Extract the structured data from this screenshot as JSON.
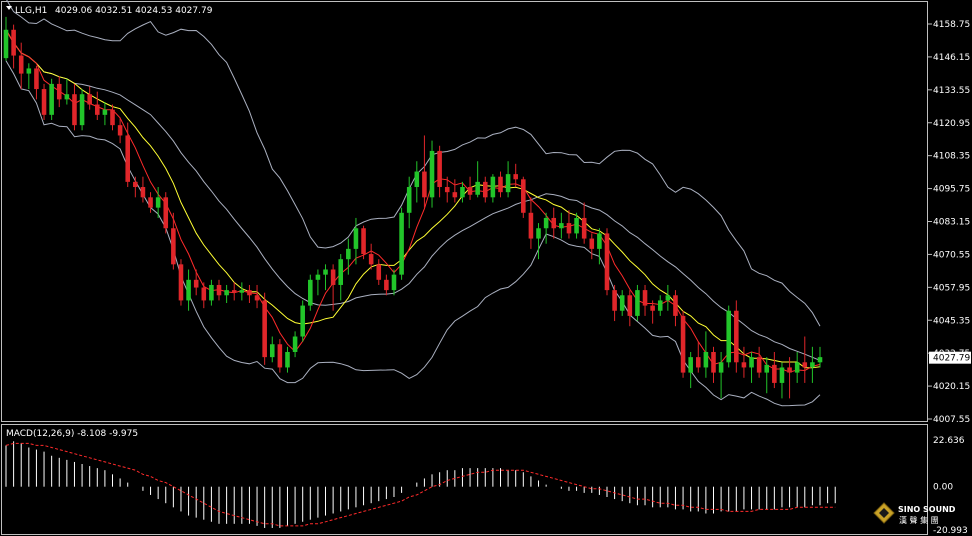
{
  "header": {
    "symbol": "LLG,H1",
    "ohlc": "4029.06 4032.51 4024.53 4027.79"
  },
  "macd_header": {
    "label": "MACD(12,26,9) -8.108 -9.975"
  },
  "price_axis": {
    "ticks": [
      "4158.75",
      "4146.15",
      "4133.55",
      "4120.95",
      "4108.35",
      "4095.75",
      "4083.15",
      "4070.55",
      "4057.95",
      "4045.35",
      "4032.75",
      "4020.15",
      "4007.55"
    ],
    "current_price": "4027.79"
  },
  "macd_axis": {
    "ticks": [
      "22.636",
      "0.00",
      "-20.993"
    ]
  },
  "logo": {
    "name": "SINO SOUND",
    "cn": "漢 聲 集 團"
  },
  "colors": {
    "bull": "#22c52a",
    "bear": "#e0262a",
    "fast_ma": "#ff2b2b",
    "slow_ma": "#ffff33",
    "bands": "#aab0c0",
    "macd_signal": "#ff2b2b",
    "macd_hist": "#ffffff"
  },
  "chart_data": {
    "type": "candlestick",
    "timeframe": "H1",
    "ylim": [
      4004,
      4165
    ],
    "candles": [
      [
        4144,
        4160,
        4143,
        4155
      ],
      [
        4155,
        4157,
        4140,
        4145
      ],
      [
        4145,
        4150,
        4132,
        4138
      ],
      [
        4138,
        4142,
        4132,
        4140
      ],
      [
        4140,
        4141,
        4128,
        4132
      ],
      [
        4132,
        4134,
        4120,
        4122
      ],
      [
        4122,
        4136,
        4120,
        4134
      ],
      [
        4134,
        4137,
        4125,
        4128
      ],
      [
        4128,
        4136,
        4126,
        4130
      ],
      [
        4130,
        4134,
        4116,
        4118
      ],
      [
        4118,
        4132,
        4116,
        4130
      ],
      [
        4130,
        4133,
        4124,
        4126
      ],
      [
        4126,
        4131,
        4120,
        4122
      ],
      [
        4122,
        4127,
        4118,
        4124
      ],
      [
        4124,
        4126,
        4116,
        4118
      ],
      [
        4118,
        4121,
        4111,
        4114
      ],
      [
        4114,
        4119,
        4094,
        4096
      ],
      [
        4096,
        4098,
        4090,
        4094
      ],
      [
        4094,
        4098,
        4088,
        4090
      ],
      [
        4090,
        4092,
        4084,
        4086
      ],
      [
        4086,
        4094,
        4082,
        4090
      ],
      [
        4090,
        4092,
        4076,
        4078
      ],
      [
        4078,
        4084,
        4062,
        4064
      ],
      [
        4064,
        4066,
        4048,
        4050
      ],
      [
        4050,
        4062,
        4046,
        4058
      ],
      [
        4058,
        4062,
        4052,
        4055
      ],
      [
        4055,
        4057,
        4047,
        4050
      ],
      [
        4050,
        4058,
        4048,
        4056
      ],
      [
        4056,
        4058,
        4050,
        4052
      ],
      [
        4052,
        4056,
        4049,
        4054
      ],
      [
        4054,
        4057,
        4050,
        4053
      ],
      [
        4053,
        4057,
        4050,
        4054
      ],
      [
        4054,
        4056,
        4049,
        4052
      ],
      [
        4052,
        4056,
        4047,
        4050
      ],
      [
        4050,
        4053,
        4025,
        4028
      ],
      [
        4028,
        4036,
        4026,
        4033
      ],
      [
        4033,
        4035,
        4022,
        4024
      ],
      [
        4024,
        4032,
        4022,
        4030
      ],
      [
        4030,
        4038,
        4028,
        4036
      ],
      [
        4036,
        4050,
        4034,
        4048
      ],
      [
        4048,
        4060,
        4046,
        4058
      ],
      [
        4058,
        4062,
        4052,
        4060
      ],
      [
        4060,
        4064,
        4054,
        4062
      ],
      [
        4062,
        4064,
        4046,
        4056
      ],
      [
        4056,
        4068,
        4050,
        4066
      ],
      [
        4066,
        4074,
        4060,
        4070
      ],
      [
        4070,
        4082,
        4064,
        4078
      ],
      [
        4078,
        4079,
        4066,
        4068
      ],
      [
        4068,
        4072,
        4062,
        4064
      ],
      [
        4064,
        4066,
        4056,
        4058
      ],
      [
        4058,
        4060,
        4052,
        4054
      ],
      [
        4054,
        4062,
        4052,
        4060
      ],
      [
        4060,
        4086,
        4058,
        4084
      ],
      [
        4084,
        4098,
        4078,
        4094
      ],
      [
        4094,
        4104,
        4088,
        4100
      ],
      [
        4100,
        4114,
        4086,
        4090
      ],
      [
        4090,
        4112,
        4086,
        4108
      ],
      [
        4108,
        4110,
        4090,
        4094
      ],
      [
        4094,
        4098,
        4088,
        4092
      ],
      [
        4092,
        4097,
        4088,
        4090
      ],
      [
        4090,
        4096,
        4088,
        4094
      ],
      [
        4094,
        4098,
        4089,
        4091
      ],
      [
        4091,
        4104,
        4090,
        4096
      ],
      [
        4096,
        4098,
        4088,
        4090
      ],
      [
        4090,
        4099,
        4088,
        4098
      ],
      [
        4098,
        4100,
        4090,
        4092
      ],
      [
        4092,
        4104,
        4090,
        4099
      ],
      [
        4099,
        4103,
        4094,
        4097
      ],
      [
        4097,
        4098,
        4082,
        4084
      ],
      [
        4084,
        4090,
        4070,
        4074
      ],
      [
        4074,
        4080,
        4066,
        4078
      ],
      [
        4078,
        4084,
        4072,
        4082
      ],
      [
        4082,
        4086,
        4074,
        4078
      ],
      [
        4078,
        4084,
        4074,
        4080
      ],
      [
        4080,
        4085,
        4074,
        4076
      ],
      [
        4076,
        4084,
        4074,
        4082
      ],
      [
        4082,
        4088,
        4072,
        4074
      ],
      [
        4074,
        4076,
        4066,
        4070
      ],
      [
        4070,
        4078,
        4064,
        4076
      ],
      [
        4076,
        4078,
        4052,
        4054
      ],
      [
        4054,
        4056,
        4042,
        4046
      ],
      [
        4046,
        4054,
        4044,
        4052
      ],
      [
        4052,
        4054,
        4040,
        4044
      ],
      [
        4044,
        4056,
        4042,
        4054
      ],
      [
        4054,
        4056,
        4044,
        4048
      ],
      [
        4048,
        4050,
        4041,
        4046
      ],
      [
        4046,
        4052,
        4044,
        4050
      ],
      [
        4050,
        4056,
        4046,
        4052
      ],
      [
        4052,
        4054,
        4040,
        4044
      ],
      [
        4044,
        4046,
        4020,
        4022
      ],
      [
        4022,
        4030,
        4016,
        4028
      ],
      [
        4028,
        4034,
        4022,
        4024
      ],
      [
        4024,
        4038,
        4020,
        4030
      ],
      [
        4030,
        4032,
        4018,
        4022
      ],
      [
        4022,
        4030,
        4012,
        4026
      ],
      [
        4026,
        4048,
        4024,
        4046
      ],
      [
        4046,
        4050,
        4022,
        4026
      ],
      [
        4026,
        4032,
        4020,
        4024
      ],
      [
        4024,
        4030,
        4018,
        4028
      ],
      [
        4028,
        4032,
        4020,
        4022
      ],
      [
        4022,
        4028,
        4014,
        4025
      ],
      [
        4025,
        4030,
        4016,
        4018
      ],
      [
        4018,
        4026,
        4012,
        4024
      ],
      [
        4024,
        4028,
        4012,
        4022
      ],
      [
        4022,
        4030,
        4018,
        4026
      ],
      [
        4026,
        4036,
        4018,
        4024
      ],
      [
        4024,
        4032,
        4018,
        4026
      ],
      [
        4026,
        4032,
        4024,
        4028
      ]
    ],
    "macd_hist": [
      20,
      22,
      21,
      19,
      18,
      17,
      15,
      14,
      13,
      12,
      11,
      10,
      9,
      8,
      6,
      4,
      2,
      0,
      -2,
      -4,
      -6,
      -8,
      -10,
      -12,
      -14,
      -15,
      -16,
      -17,
      -18,
      -18,
      -18,
      -18,
      -18,
      -19,
      -20,
      -20,
      -20,
      -19,
      -18,
      -17,
      -16,
      -15,
      -14,
      -13,
      -12,
      -11,
      -10,
      -9,
      -8,
      -7,
      -6,
      -5,
      -3,
      0,
      2,
      4,
      6,
      7,
      8,
      8,
      9,
      9,
      9,
      9,
      9,
      9,
      8,
      8,
      7,
      5,
      3,
      1,
      0,
      -1,
      -2,
      -2,
      -3,
      -3,
      -4,
      -5,
      -6,
      -7,
      -8,
      -9,
      -9,
      -10,
      -10,
      -10,
      -11,
      -11,
      -12,
      -12,
      -13,
      -13,
      -12,
      -12,
      -12,
      -11,
      -11,
      -11,
      -11,
      -11,
      -10,
      -10,
      -10,
      -10,
      -9,
      -9,
      -8,
      -8
    ],
    "macd_signal": [
      20,
      21,
      21,
      21,
      20,
      20,
      19,
      18,
      17,
      16,
      15,
      14,
      13,
      12,
      11,
      10,
      9,
      8,
      6,
      5,
      3,
      2,
      0,
      -2,
      -4,
      -6,
      -8,
      -10,
      -12,
      -13,
      -14,
      -15,
      -16,
      -17,
      -18,
      -18,
      -19,
      -19,
      -19,
      -19,
      -18,
      -18,
      -17,
      -16,
      -15,
      -14,
      -13,
      -12,
      -11,
      -10,
      -9,
      -8,
      -7,
      -5,
      -4,
      -2,
      0,
      1,
      3,
      4,
      5,
      6,
      7,
      7,
      8,
      8,
      8,
      8,
      8,
      7,
      6,
      5,
      4,
      3,
      2,
      1,
      0,
      -1,
      -1,
      -2,
      -3,
      -4,
      -5,
      -6,
      -6,
      -7,
      -8,
      -8,
      -9,
      -9,
      -10,
      -10,
      -11,
      -11,
      -11,
      -12,
      -12,
      -12,
      -12,
      -11,
      -11,
      -11,
      -11,
      -11,
      -10,
      -10,
      -10,
      -10,
      -10,
      -10
    ]
  }
}
